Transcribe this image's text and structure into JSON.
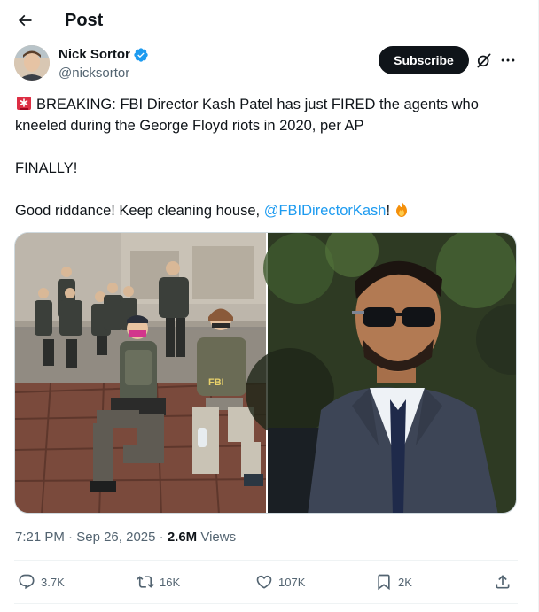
{
  "header": {
    "title": "Post",
    "back_icon": "arrow-left-icon"
  },
  "author": {
    "name": "Nick Sortor",
    "handle": "@nicksortor",
    "verified": true,
    "verified_color": "#1d9bf0"
  },
  "actions_top": {
    "subscribe_label": "Subscribe",
    "grok_icon": "grok-icon",
    "more_icon": "more-horizontal-icon"
  },
  "tweet": {
    "line1": "BREAKING: FBI Director Kash Patel has just FIRED the agents who",
    "line2": "kneeled during the George Floyd riots in 2020, per AP",
    "line3": "FINALLY!",
    "line4_prefix": "Good riddance! Keep cleaning house, ",
    "mention": "@FBIDirectorKash",
    "line4_suffix": "!",
    "leading_emoji": "siren-icon",
    "trailing_emoji": "fire-icon",
    "mention_color": "#1d9bf0"
  },
  "media": {
    "images": [
      {
        "name": "fbi-agents-kneeling-photo"
      },
      {
        "name": "kash-patel-sunglasses-photo"
      }
    ]
  },
  "meta": {
    "time": "7:21 PM",
    "separator": " · ",
    "date": "Sep 26, 2025",
    "views_count": "2.6M",
    "views_label": " Views"
  },
  "engagement": {
    "replies": "3.7K",
    "reposts": "16K",
    "likes": "107K",
    "bookmarks": "2K"
  }
}
